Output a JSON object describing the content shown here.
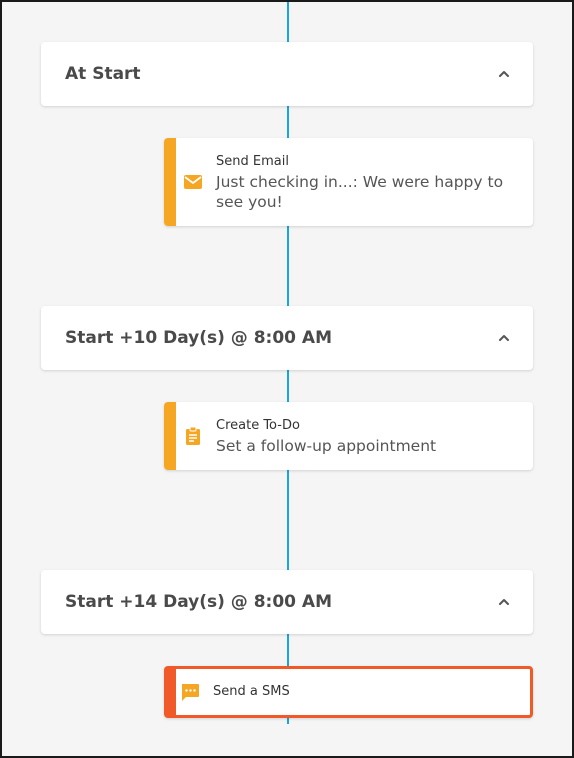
{
  "steps": [
    {
      "title": "At Start",
      "action": {
        "type": "Send Email",
        "description": "Just checking in...: We were happy to see you!",
        "icon": "email-icon"
      }
    },
    {
      "title": "Start +10 Day(s) @ 8:00 AM",
      "action": {
        "type": "Create To-Do",
        "description": "Set a follow-up appointment",
        "icon": "clipboard-icon"
      }
    },
    {
      "title": "Start +14 Day(s) @ 8:00 AM",
      "action": {
        "type": "Send a SMS",
        "description": "",
        "icon": "sms-icon",
        "selected": true
      }
    }
  ],
  "colors": {
    "timeline": "#1aa3e8",
    "action_accent": "#f5a623",
    "selected_border": "#f05a28"
  }
}
